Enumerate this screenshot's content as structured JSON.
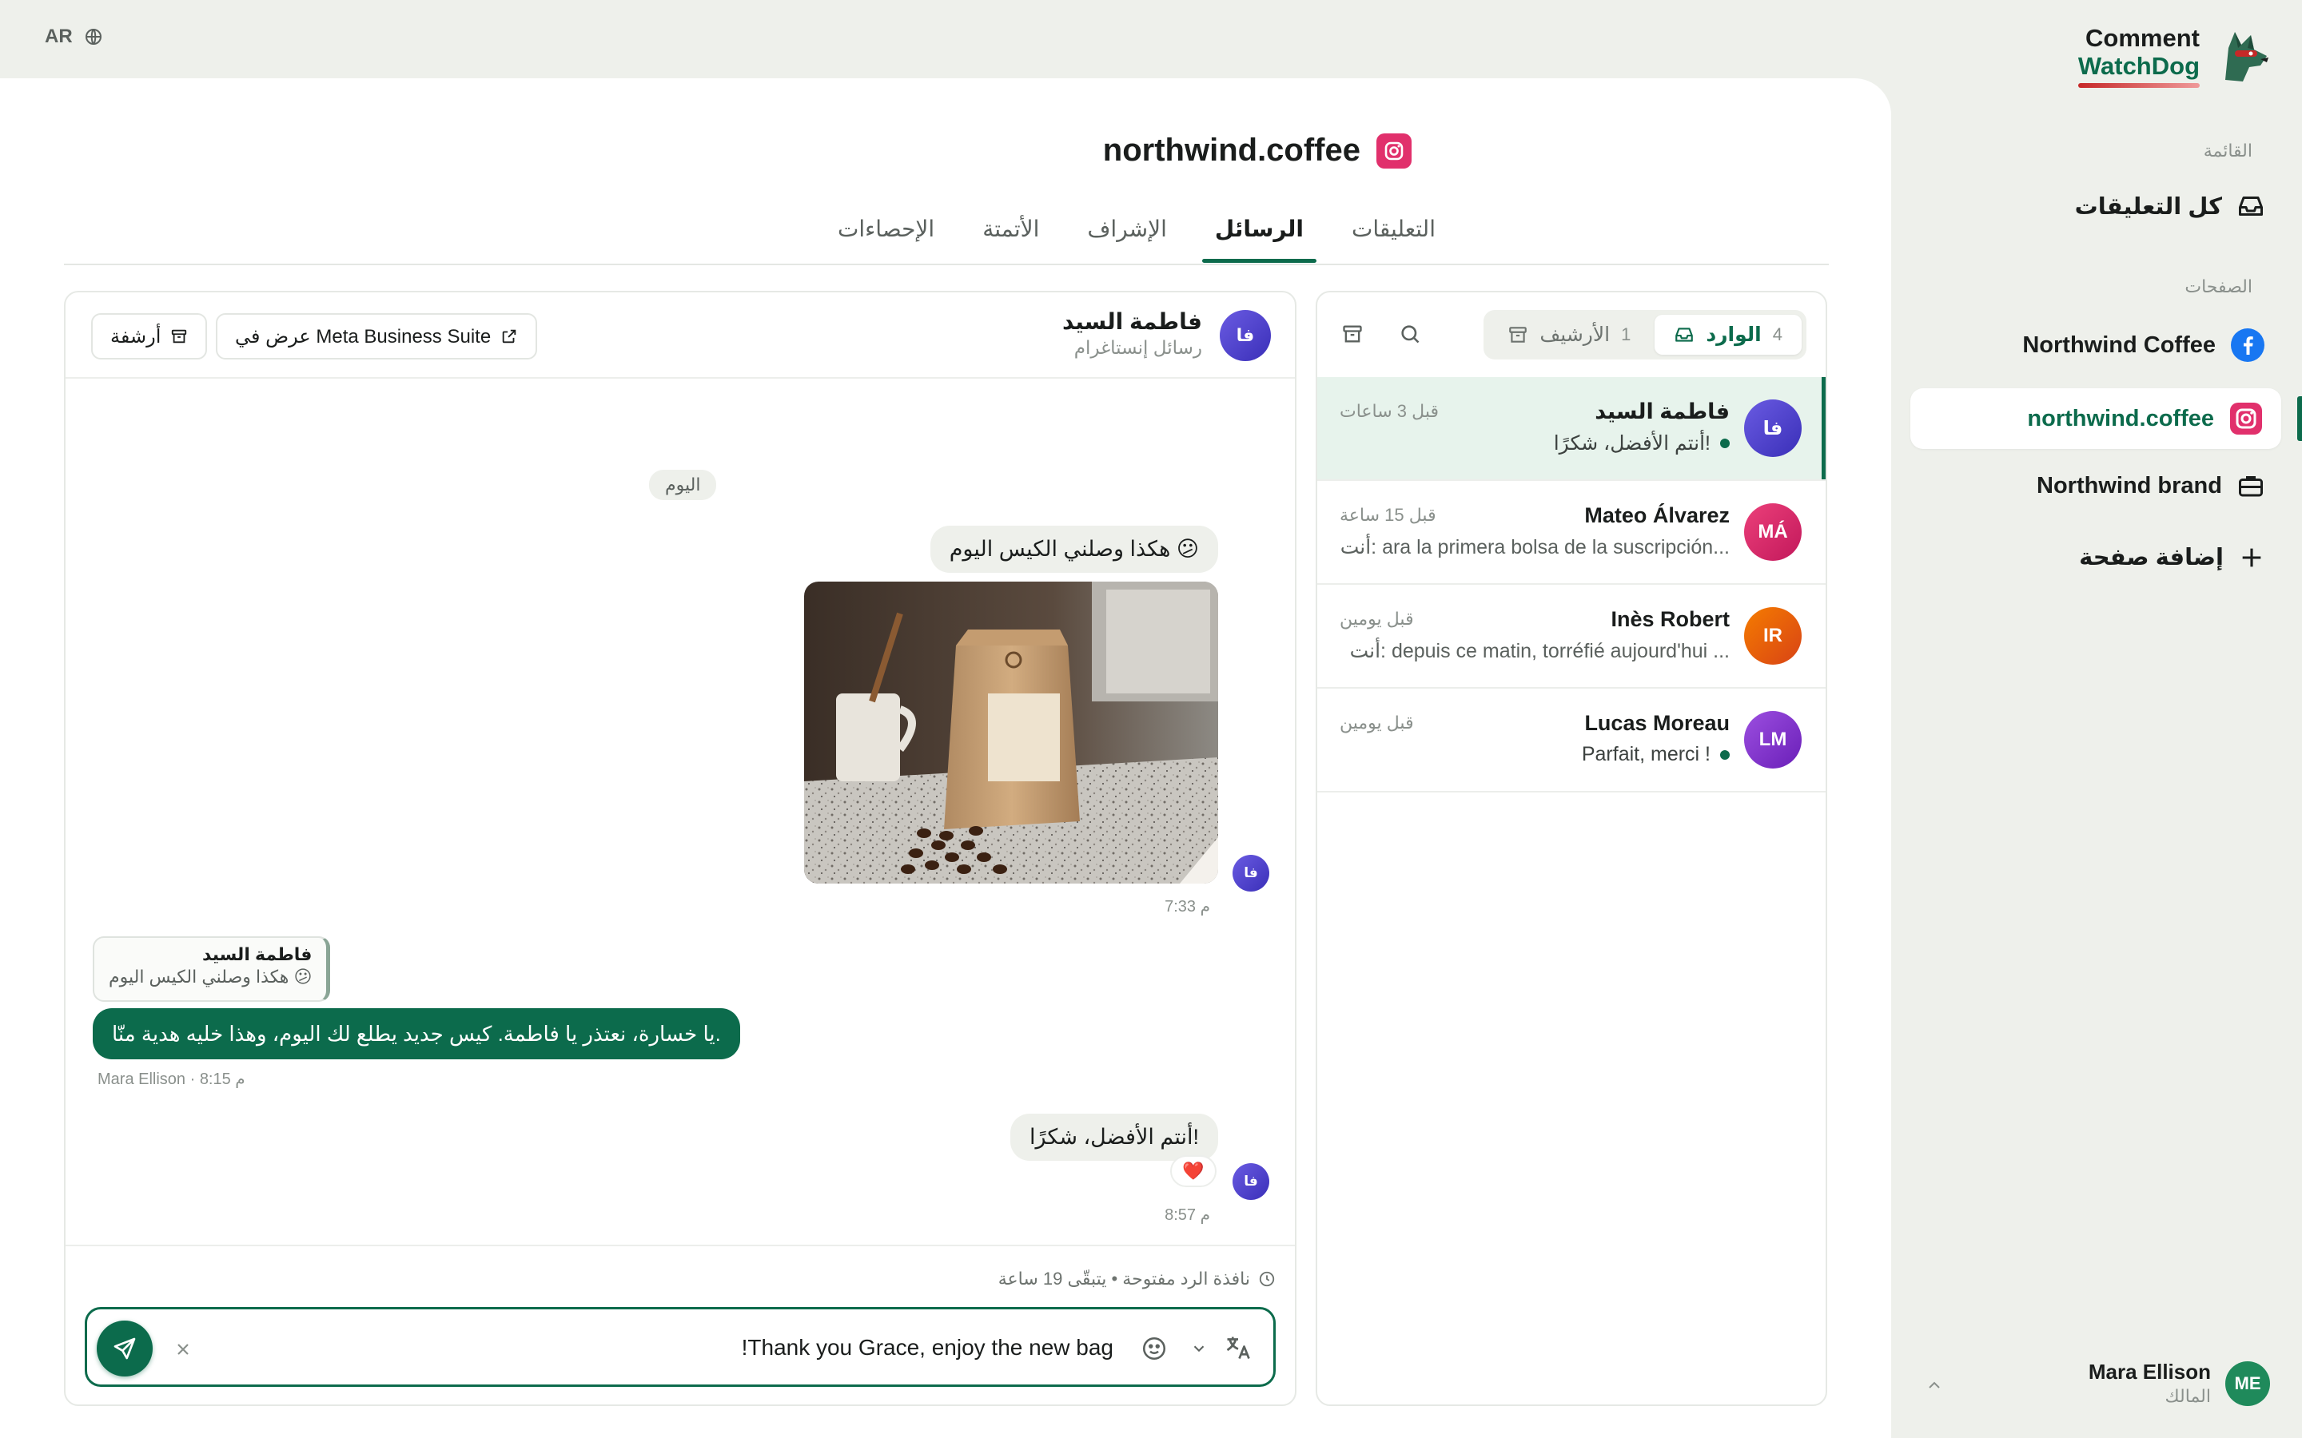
{
  "lang": {
    "code": "AR"
  },
  "brand": {
    "line1": "Comment",
    "line2": "WatchDog"
  },
  "sidebar": {
    "menu_label": "القائمة",
    "all_comments": "كل التعليقات",
    "pages_label": "الصفحات",
    "pages": [
      {
        "label": "Northwind Coffee",
        "icon": "facebook-icon"
      },
      {
        "label": "northwind.coffee",
        "icon": "instagram-icon"
      },
      {
        "label": "Northwind brand",
        "icon": "briefcase-icon"
      }
    ],
    "add_page": "إضافة صفحة"
  },
  "user": {
    "initials": "ME",
    "name": "Mara Ellison",
    "role": "المالك"
  },
  "page": {
    "title": "northwind.coffee"
  },
  "tabs": [
    "التعليقات",
    "الرسائل",
    "الإشراف",
    "الأتمتة",
    "الإحصاءات"
  ],
  "inbox": {
    "inbox_label": "الوارد",
    "inbox_count": "4",
    "archive_label": "الأرشيف",
    "archive_count": "1",
    "conversations": [
      {
        "initials": "فا",
        "name": "فاطمة السيد",
        "time": "قبل 3 ساعات",
        "preview": "أنتم الأفضل، شكرًا!",
        "unread": true,
        "color": "#4a3fd0"
      },
      {
        "initials": "MÁ",
        "name": "Mateo Álvarez",
        "time": "قبل 15 ساعة",
        "preview": "أنت: ara la primera bolsa de la suscripción...",
        "unread": false,
        "color": "#d81b60"
      },
      {
        "initials": "IR",
        "name": "Inès Robert",
        "time": "قبل يومين",
        "preview": "أنت: depuis ce matin, torréfié aujourd'hui ...",
        "unread": false,
        "color": "#e65100"
      },
      {
        "initials": "LM",
        "name": "Lucas Moreau",
        "time": "قبل يومين",
        "preview": "Parfait, merci !",
        "unread": true,
        "color": "#8e24aa"
      }
    ]
  },
  "chat": {
    "contact_initials": "فا",
    "contact_name": "فاطمة السيد",
    "contact_sub": "رسائل إنستاغرام",
    "open_meta_label": "عرض في Meta Business Suite",
    "archive_label": "أرشفة",
    "day_label": "اليوم",
    "msg1": {
      "text": "هكذا وصلني الكيس اليوم 😕",
      "time": "7:33 م"
    },
    "quote": {
      "name": "فاطمة السيد",
      "text": "هكذا وصلني الكيس اليوم 😕"
    },
    "reply": {
      "text": "يا خسارة، نعتذر يا فاطمة. كيس جديد يطلع لك اليوم، وهذا خليه هدية منّا.",
      "meta": "Mara Ellison · 8:15 م"
    },
    "msg2": {
      "text": "أنتم الأفضل، شكرًا!",
      "reaction": "❤️",
      "time": "8:57 م"
    },
    "reply_window": "نافذة الرد مفتوحة • يتبقّى 19 ساعة",
    "draft": "!Thank you Grace, enjoy the new bag"
  },
  "colors": {
    "accent": "#0c6b4c",
    "instagram": "#e1306c",
    "facebook": "#1877f2"
  }
}
